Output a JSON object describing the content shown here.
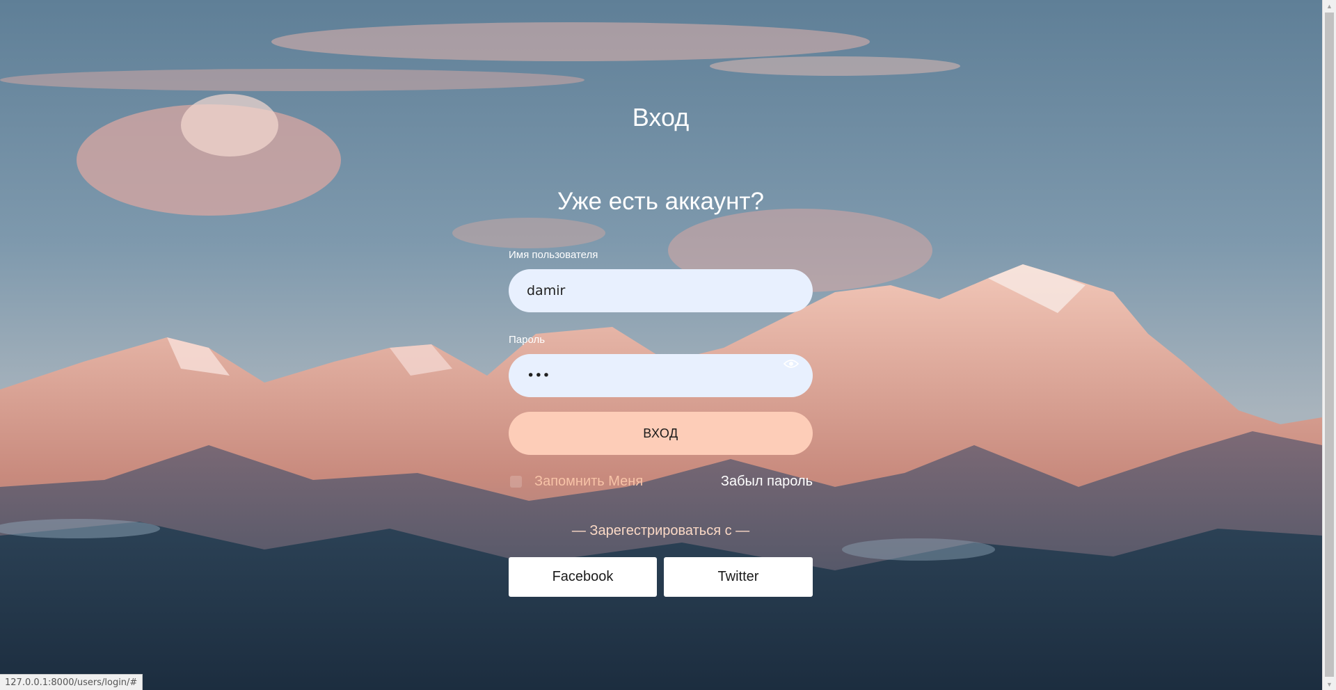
{
  "login": {
    "title": "Вход",
    "subtitle": "Уже есть аккаунт?",
    "username_label": "Имя пользователя",
    "username_value": "damir",
    "password_label": "Пароль",
    "password_value": "•••",
    "submit_label": "ВХОД",
    "remember_label": "Запомнить Меня",
    "forgot_label": "Забыл пароль",
    "register_label": "— Зарегестрироваться с —",
    "social": [
      {
        "label": "Facebook"
      },
      {
        "label": "Twitter"
      }
    ]
  },
  "status_bar": {
    "url": "127.0.0.1:8000/users/login/#"
  },
  "icons": {
    "password_toggle": "eye-icon",
    "scroll_up": "arrow-up-icon",
    "scroll_down": "arrow-down-icon"
  },
  "colors": {
    "input_background": "#e8f0fe",
    "submit_background": "#fdcdb8",
    "accent_text": "#f7c3a7"
  }
}
